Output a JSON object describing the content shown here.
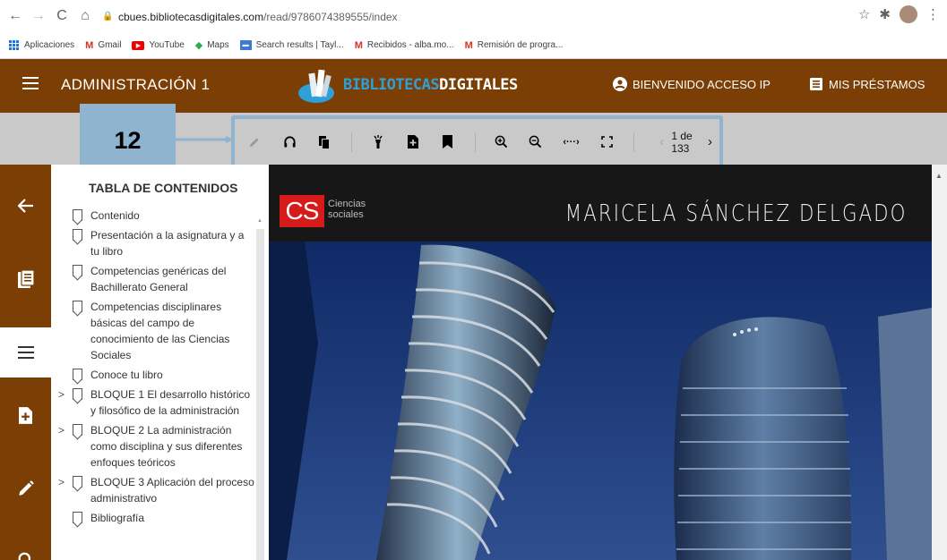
{
  "browser": {
    "url_host": "cbues.bibliotecasdigitales.com",
    "url_path": "/read/9786074389555/index",
    "bookmarks": [
      {
        "label": "Aplicaciones",
        "icon": "apps-icon"
      },
      {
        "label": "Gmail",
        "icon": "gmail-icon"
      },
      {
        "label": "YouTube",
        "icon": "youtube-icon"
      },
      {
        "label": "Maps",
        "icon": "maps-icon"
      },
      {
        "label": "Search results | Tayl...",
        "icon": "search-results-icon"
      },
      {
        "label": "Recibidos - alba.mo...",
        "icon": "gmail-icon"
      },
      {
        "label": "Remisión de progra...",
        "icon": "gmail-icon"
      }
    ]
  },
  "header": {
    "title": "ADMINISTRACIÓN 1",
    "logo_part1": "BIBLIOTECAS",
    "logo_part2": "DIGITALES",
    "welcome": "BIENVENIDO ACCESO IP",
    "loans": "MIS PRÉSTAMOS",
    "bg_color": "#7b3f06"
  },
  "toolbar": {
    "page_indicator": "1 de 133",
    "tools": [
      "pencil-icon",
      "headphones-icon",
      "copy-icon",
      "highlighter-icon",
      "add-note-icon",
      "bookmark-icon",
      "zoom-in-icon",
      "zoom-out-icon",
      "fit-width-icon",
      "fullscreen-icon"
    ]
  },
  "callout": {
    "label": "12",
    "color": "#8fb4d0"
  },
  "rail": {
    "items": [
      "back-arrow-icon",
      "library-icon",
      "menu-icon",
      "add-note-icon",
      "pencil-icon",
      "search-icon"
    ]
  },
  "toc": {
    "title": "TABLA DE CONTENIDOS",
    "items": [
      {
        "label": "Contenido",
        "expandable": false
      },
      {
        "label": "Presentación a la asignatura y a tu libro",
        "expandable": false
      },
      {
        "label": "Competencias genéricas del Bachillerato General",
        "expandable": false
      },
      {
        "label": "Competencias disciplinares básicas del campo de conocimiento de las Ciencias Sociales",
        "expandable": false
      },
      {
        "label": "Conoce tu libro",
        "expandable": false
      },
      {
        "label": "BLOQUE 1 El desarrollo histórico y filosófico de la administración",
        "expandable": true
      },
      {
        "label": "BLOQUE 2 La administración como disciplina y sus diferentes enfoques teóricos",
        "expandable": true
      },
      {
        "label": "BLOQUE 3 Aplicación del proceso administrativo",
        "expandable": true
      },
      {
        "label": "Bibliografía",
        "expandable": false
      }
    ]
  },
  "document": {
    "logo": "CS",
    "logo_sub1": "Ciencias",
    "logo_sub2": "sociales",
    "author": "MARICELA SÁNCHEZ DELGADO"
  }
}
